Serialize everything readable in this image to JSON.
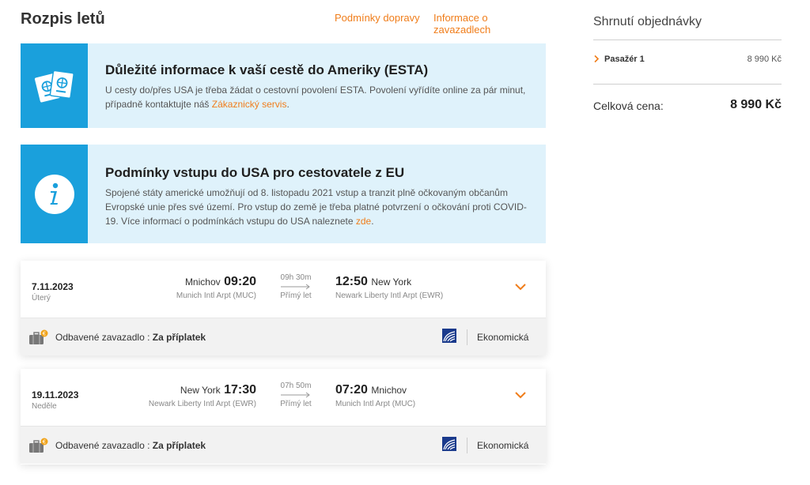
{
  "header": {
    "title": "Rozpis letů",
    "link_conditions": "Podmínky dopravy",
    "link_baggage": "Informace o zavazadlech"
  },
  "esta": {
    "title": "Důležité informace k vaší cestě do Ameriky (ESTA)",
    "text": "U cesty do/přes USA je třeba žádat o cestovní povolení ESTA. Povolení vyřídíte online za pár minut, případně kontaktujte náš ",
    "link": "Zákaznický servis",
    "text_end": "."
  },
  "entry": {
    "title": "Podmínky vstupu do USA pro cestovatele z EU",
    "text": "Spojené státy americké umožňují od 8. listopadu 2021 vstup a tranzit plně očkovaným občanům Evropské unie přes své území. Pro vstup do země je třeba platné potvrzení o očkování proti COVID-19. Více informací o podmínkách vstupu do USA naleznete ",
    "link": "zde",
    "text_end": "."
  },
  "flights": [
    {
      "date": "7.11.2023",
      "day": "Úterý",
      "dep_city": "Mnichov",
      "dep_time": "09:20",
      "dep_airport": "Munich Intl Arpt (MUC)",
      "duration": "09h 30m",
      "stops": "Přímý let",
      "arr_time": "12:50",
      "arr_city": "New York",
      "arr_airport": "Newark Liberty Intl Arpt (EWR)",
      "bag_label": "Odbavené zavazadlo : ",
      "bag_value": "Za příplatek",
      "cabin": "Ekonomická"
    },
    {
      "date": "19.11.2023",
      "day": "Neděle",
      "dep_city": "New York",
      "dep_time": "17:30",
      "dep_airport": "Newark Liberty Intl Arpt (EWR)",
      "duration": "07h 50m",
      "stops": "Přímý let",
      "arr_time": "07:20",
      "arr_city": "Mnichov",
      "arr_airport": "Munich Intl Arpt (MUC)",
      "bag_label": "Odbavené zavazadlo : ",
      "bag_value": "Za příplatek",
      "cabin": "Ekonomická"
    }
  ],
  "summary": {
    "title": "Shrnutí objednávky",
    "passenger_label": "Pasažér 1",
    "passenger_price": "8 990 Kč",
    "total_label": "Celková cena:",
    "total_value": "8 990 Kč"
  },
  "icons": {
    "esta": "passport-icon",
    "entry": "info-icon",
    "expand": "chevron-down-icon",
    "baggage": "suitcase-icon",
    "airline": "airline-logo-icon"
  },
  "colors": {
    "accent": "#f07d1a",
    "info_bg": "#dff2fb",
    "info_icon_bg": "#1aa0dc"
  }
}
